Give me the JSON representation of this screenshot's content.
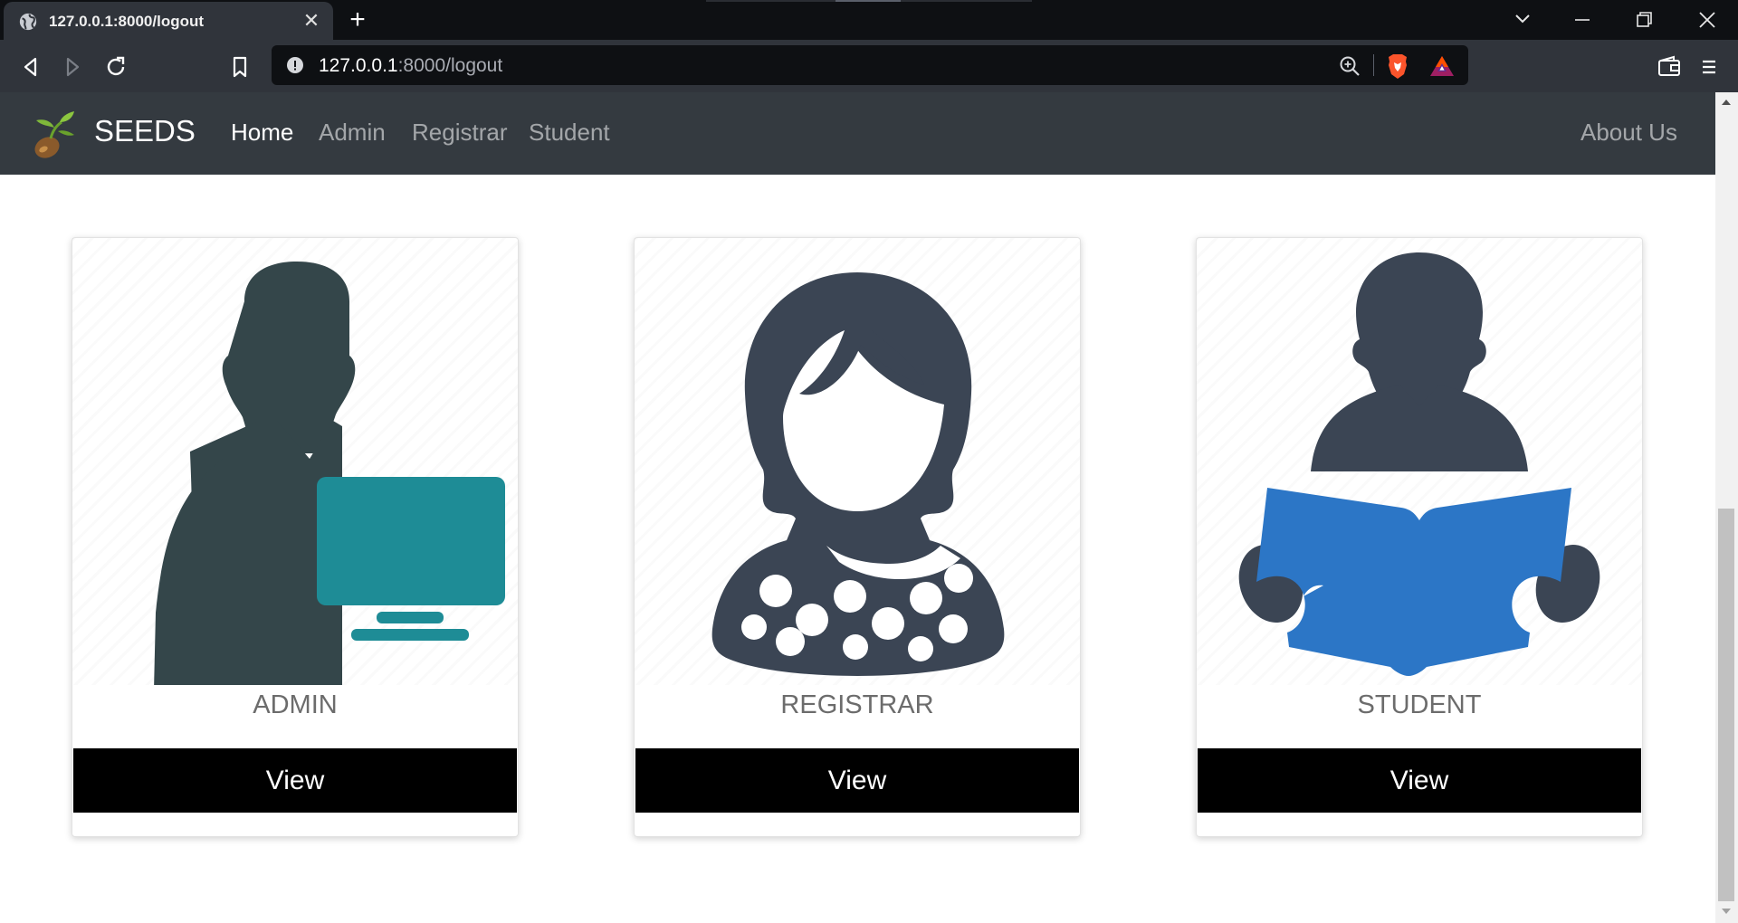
{
  "browser": {
    "tab_title": "127.0.0.1:8000/logout",
    "url_host": "127.0.0.1",
    "url_rest": ":8000/logout"
  },
  "site": {
    "brand": "SEEDS",
    "nav": [
      {
        "label": "Home",
        "active": true
      },
      {
        "label": "Admin",
        "active": false
      },
      {
        "label": "Registrar",
        "active": false
      },
      {
        "label": "Student",
        "active": false
      }
    ],
    "about_label": "About Us"
  },
  "cards": [
    {
      "title": "ADMIN",
      "button": "View",
      "icon": "admin-computer-icon"
    },
    {
      "title": "REGISTRAR",
      "button": "View",
      "icon": "registrar-woman-icon"
    },
    {
      "title": "STUDENT",
      "button": "View",
      "icon": "student-reading-icon"
    }
  ],
  "colors": {
    "navbar": "#343a40",
    "monitor": "#1e8c96",
    "book": "#2c76c6",
    "silhouette": "#3b4554",
    "admin_silhouette": "#34464a"
  }
}
